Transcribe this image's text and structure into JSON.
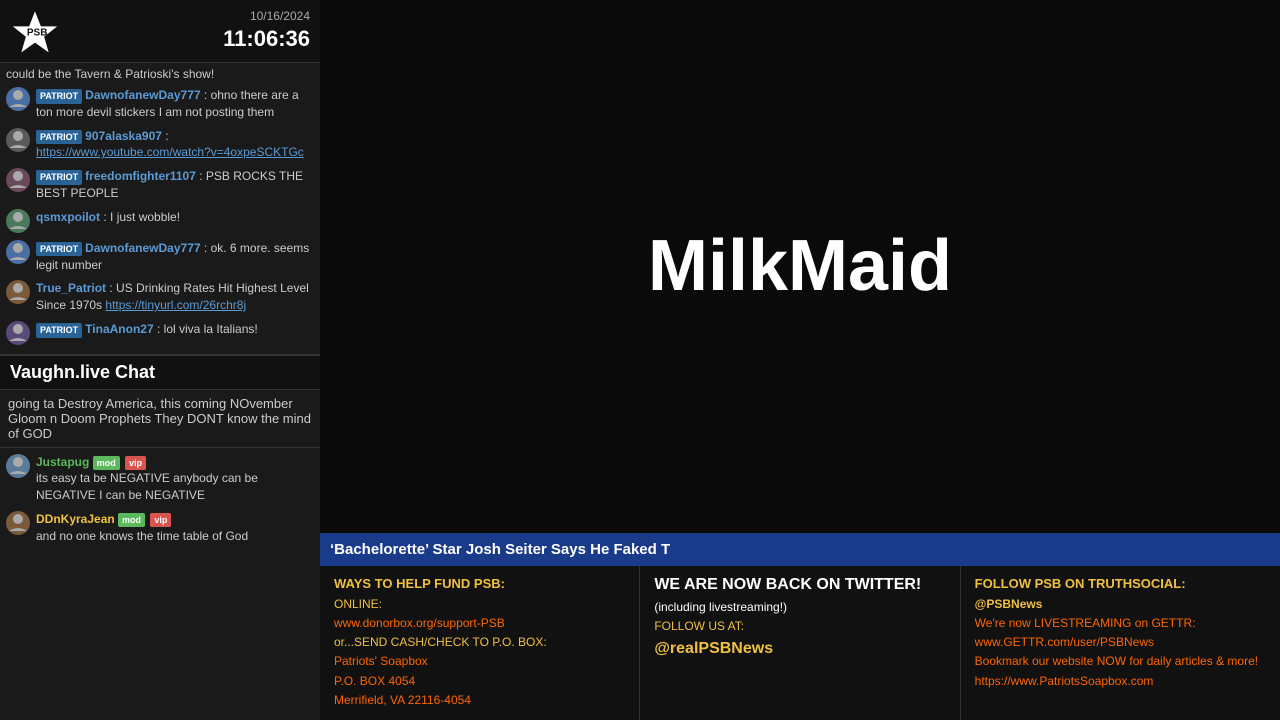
{
  "header": {
    "date": "10/16/2024",
    "time": "11:06:36"
  },
  "vaughn_banner": {
    "title": "Vaughn.live Chat"
  },
  "video": {
    "title": "MilkMaid"
  },
  "ticker": {
    "text": "‘Bachelorette’ Star Josh Seiter Says He Faked T"
  },
  "chat_messages_top": [
    {
      "avatar_char": "D",
      "badge": "PATRIOT",
      "username": "DawnofanewDay777",
      "separator": " : ",
      "text": "ohno there are a ton more devil stickers I am not posting them"
    },
    {
      "avatar_char": "9",
      "badge": "PATRIOT",
      "username": "907alaska907",
      "separator": " : ",
      "text": "https://www.youtube.com/watch?v=4oxpeSCKTGc",
      "is_link": true
    },
    {
      "avatar_char": "f",
      "badge": "PATRIOT",
      "username": "freedomfighter1107",
      "separator": " : ",
      "text": "PSB ROCKS THE BEST PEOPLE"
    },
    {
      "avatar_char": "q",
      "badge": "",
      "username": "qsmxpoilot",
      "separator": " : ",
      "text": "I just wobble!"
    },
    {
      "avatar_char": "D",
      "badge": "PATRIOT",
      "username": "DawnofanewDay777",
      "separator": " : ",
      "text": "ok. 6 more. seems legit number"
    },
    {
      "avatar_char": "T",
      "badge": "",
      "username": "True_Patriot",
      "separator": " : ",
      "text": "US Drinking Rates Hit Highest Level Since 1970s https://tinyurl.com/26rchr8j",
      "has_link": true,
      "link": "https://tinyurl.com/26rchr8j"
    },
    {
      "avatar_char": "T",
      "badge": "PATRIOT",
      "username": "TinaAnon27",
      "separator": " : ",
      "text": "lol viva la Italians!"
    }
  ],
  "static_chat_text": "could be the Tavern & Patrioski's show!",
  "chat_messages_bottom": [
    {
      "avatar_char": "J",
      "badge": "",
      "badge2": "",
      "username": "Justapug",
      "has_mod": true,
      "has_vip": true,
      "username_color": "green",
      "text": "its easy ta be NEGATIVE anybody can be NEGATIVE I can be NEGATIVE"
    },
    {
      "avatar_char": "D",
      "badge": "",
      "username": "DDnKyraJean",
      "has_mod": true,
      "has_vip": true,
      "username_color": "yellow",
      "text": "and no one knows the time table of God"
    }
  ],
  "big_chat_text": "going ta Destroy America, this coming NOvember Gloom n Doom Prophets They DONT know the mind of GOD",
  "bottom_bar": {
    "col1": {
      "title": "WAYS TO HELP FUND PSB:",
      "line1": "ONLINE:",
      "line2": "www.donorbox.org/support-PSB",
      "line3": "or...SEND CASH/CHECK TO P.O. BOX:",
      "line4": "Patriots' Soapbox",
      "line5": "P.O. BOX 4054",
      "line6": "Merrifield, VA 22116-4054"
    },
    "col2": {
      "title": "WE ARE NOW BACK ON TWITTER!",
      "line1": "(including livestreaming!)",
      "line2": "FOLLOW US AT:",
      "line3": "@realPSBNews"
    },
    "col3": {
      "title": "FOLLOW PSB ON TRUTHSOCIAL:",
      "line1": "@PSBNews",
      "line2": "We're now LIVESTREAMING on GETTR:",
      "line3": "www.GETTR.com/user/PSBNews",
      "line4": "Bookmark our website NOW for daily articles & more!",
      "line5": "https://www.PatriotsSoapbox.com"
    }
  }
}
